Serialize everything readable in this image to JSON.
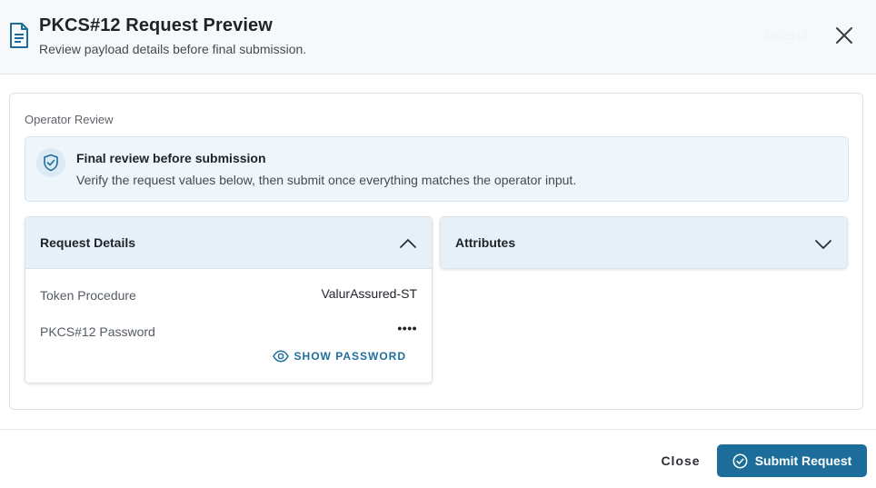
{
  "header": {
    "title": "PKCS#12 Request Preview",
    "subtitle": "Review payload details before final submission.",
    "tag": "PKCS12"
  },
  "panel": {
    "section_label": "Operator Review",
    "alert": {
      "title": "Final review before submission",
      "text": "Verify the request values below, then submit once everything matches the operator input."
    }
  },
  "request_details": {
    "title": "Request Details",
    "expanded": true,
    "rows": [
      {
        "label": "Token Procedure",
        "value": "ValurAssured-ST"
      },
      {
        "label": "PKCS#12 Password",
        "value": "••••"
      }
    ],
    "show_password_label": "SHOW PASSWORD"
  },
  "attributes": {
    "title": "Attributes",
    "expanded": false
  },
  "footer": {
    "close_label": "Close",
    "submit_label": "Submit Request"
  },
  "colors": {
    "primary": "#1c6d99",
    "header_bg": "#f6f8fa",
    "card_header_bg": "#e6f0f8",
    "alert_bg": "#eef5fb",
    "link": "#1f6f9c"
  },
  "icons": {
    "header": "document-icon",
    "close": "close-icon",
    "alert": "shield-check-icon",
    "collapse": "chevron-up-icon",
    "expand": "chevron-down-icon",
    "show_password": "eye-icon",
    "submit": "check-circle-icon"
  }
}
